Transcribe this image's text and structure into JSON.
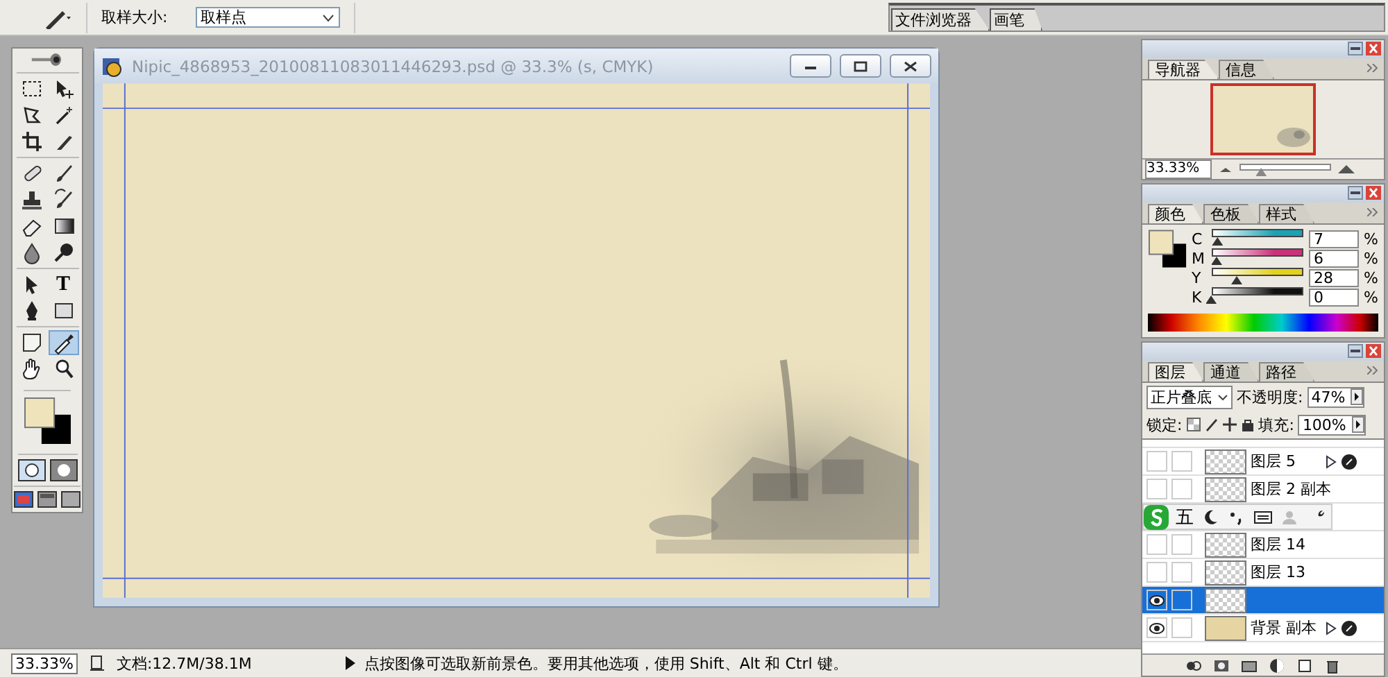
{
  "options_bar": {
    "sample_label": "取样大小:",
    "sample_value": "取样点",
    "palette_tabs": [
      {
        "label": "文件浏览器"
      },
      {
        "label": "画笔"
      }
    ]
  },
  "tools": [
    {
      "kind": "marquee",
      "selected": false
    },
    {
      "kind": "move",
      "selected": false
    },
    {
      "kind": "lasso",
      "selected": false
    },
    {
      "kind": "wand",
      "selected": false
    },
    {
      "kind": "crop",
      "selected": false
    },
    {
      "kind": "slice",
      "selected": false
    },
    {
      "kind": "heal",
      "selected": false
    },
    {
      "kind": "brush",
      "selected": false
    },
    {
      "kind": "stamp",
      "selected": false
    },
    {
      "kind": "history",
      "selected": false
    },
    {
      "kind": "eraser",
      "selected": false
    },
    {
      "kind": "gradient",
      "selected": false
    },
    {
      "kind": "blur",
      "selected": false
    },
    {
      "kind": "dodge",
      "selected": false
    },
    {
      "kind": "select",
      "selected": false
    },
    {
      "kind": "type",
      "label": "T",
      "selected": false
    },
    {
      "kind": "pen",
      "selected": false
    },
    {
      "kind": "shape",
      "selected": false
    },
    {
      "kind": "notes",
      "selected": false
    },
    {
      "kind": "eyedropper",
      "selected": true
    },
    {
      "kind": "hand",
      "selected": false
    },
    {
      "kind": "zoom",
      "selected": false
    }
  ],
  "toolbox_swatches": [
    {
      "color": "#efe3bb"
    },
    {
      "color": "#000000"
    }
  ],
  "document": {
    "title": "Nipic_4868953_20100811083011446293.psd @ 33.3% (s, CMYK)"
  },
  "navigator": {
    "tabs": [
      {
        "label": "导航器",
        "selected": true
      },
      {
        "label": "信息",
        "selected": false
      }
    ],
    "zoom": "33.33%",
    "level": 0.2
  },
  "color_panel": {
    "tabs": [
      {
        "label": "颜色",
        "selected": true
      },
      {
        "label": "色板",
        "selected": false
      },
      {
        "label": "样式",
        "selected": false
      }
    ],
    "swatches": [
      {
        "color": "#efe3bb"
      },
      {
        "color": "#000000"
      }
    ],
    "channels": [
      {
        "name": "C",
        "value": "7",
        "unit": "%",
        "level": 0.07,
        "color": "#1aa3b4"
      },
      {
        "name": "M",
        "value": "6",
        "unit": "%",
        "level": 0.06,
        "color": "#c8327a"
      },
      {
        "name": "Y",
        "value": "28",
        "unit": "%",
        "level": 0.28,
        "color": "#e3d21c"
      },
      {
        "name": "K",
        "value": "0",
        "unit": "%",
        "level": 0,
        "color": "#111111"
      }
    ]
  },
  "layers_panel": {
    "tabs": [
      {
        "label": "图层",
        "selected": true
      },
      {
        "label": "通道",
        "selected": false
      },
      {
        "label": "路径",
        "selected": false
      }
    ],
    "blend_mode": "正片叠底",
    "opacity_label": "不透明度:",
    "opacity": "47%",
    "lock_label": "锁定:",
    "fill_label": "填充:",
    "fill": "100%",
    "layers": [
      {
        "name": "图层 5",
        "kind": "checker",
        "effects": true,
        "visible": false,
        "selected": false
      },
      {
        "name": "图层 2 副本",
        "kind": "checker",
        "effects": false,
        "visible": false,
        "selected": false
      },
      {
        "selected": false,
        "overlay": {
          "kind": "ime_toolbar",
          "mode": "五"
        }
      },
      {
        "name": "图层 14",
        "kind": "checker",
        "effects": false,
        "visible": false,
        "selected": false
      },
      {
        "name": "图层 13",
        "kind": "checker",
        "effects": false,
        "visible": false,
        "selected": false
      },
      {
        "kind": "checker",
        "effects": false,
        "visible": true,
        "selected": true
      },
      {
        "name": "背景 副本",
        "kind": "paper",
        "effects": true,
        "visible": true,
        "selected": false
      }
    ]
  },
  "status_bar": {
    "zoom": "33.33%",
    "doc_size": "文档:12.7M/38.1M",
    "hint": "点按图像可选取新前景色。要用其他选项，使用 Shift、Alt 和 Ctrl 键。"
  }
}
